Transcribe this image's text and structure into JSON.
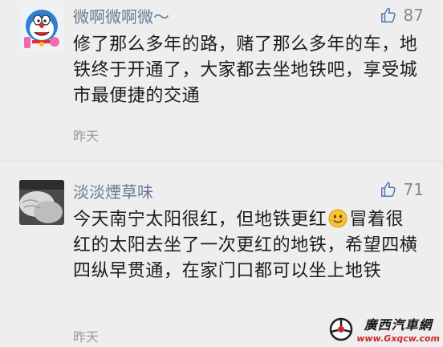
{
  "comments": [
    {
      "username": "微啊微啊微～",
      "likes": "87",
      "text": "修了那么多年的路，赌了那么多年的车，地铁终于开通了，大家都去坐地铁吧，享受城市最便捷的交通",
      "time": "昨天",
      "avatar": "doraemon-avatar"
    },
    {
      "username": "淡淡煙草味",
      "likes": "71",
      "text_before_emoji": "今天南宁太阳很红，但地铁更红",
      "emoji": "smile-emoji",
      "text_after_emoji": "冒着很红的太阳去坐了一次更红的地铁，希望四横四纵早贯通，在家门口都可以坐上地铁",
      "time": "昨天",
      "avatar": "baby-hands-avatar"
    }
  ],
  "watermark": {
    "name": "廣西汽車網",
    "url": "www.Gxqcw.com"
  },
  "colors": {
    "background": "#eeeeee",
    "username": "#687a95",
    "text": "#1c1c1c",
    "meta": "#9a9a9a"
  }
}
